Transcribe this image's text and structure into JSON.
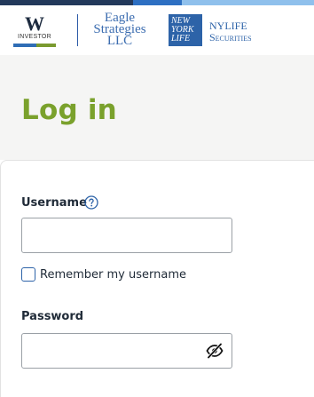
{
  "header": {
    "brand_w": {
      "letter": "W",
      "sublabel": "INVESTOR"
    },
    "brand_eagle": {
      "line1": "Eagle",
      "line2": "Strategies",
      "line3": "LLC"
    },
    "brand_nyl": {
      "box_line1": "NEW",
      "box_line2": "YORK",
      "box_line3": "LIFE",
      "text_line1": "NYLIFE",
      "text_line2": "Securities"
    }
  },
  "page": {
    "title": "Log in"
  },
  "form": {
    "username_label": "Username",
    "username_value": "",
    "remember_label": "Remember my username",
    "remember_checked": false,
    "password_label": "Password",
    "password_value": ""
  },
  "icons": {
    "help": "help-circle-icon",
    "password_toggle": "eye-slash-icon"
  },
  "colors": {
    "title_green": "#7aa12c",
    "brand_blue": "#2d63a8",
    "navy": "#23395b",
    "light_blue": "#8fc0ec"
  }
}
